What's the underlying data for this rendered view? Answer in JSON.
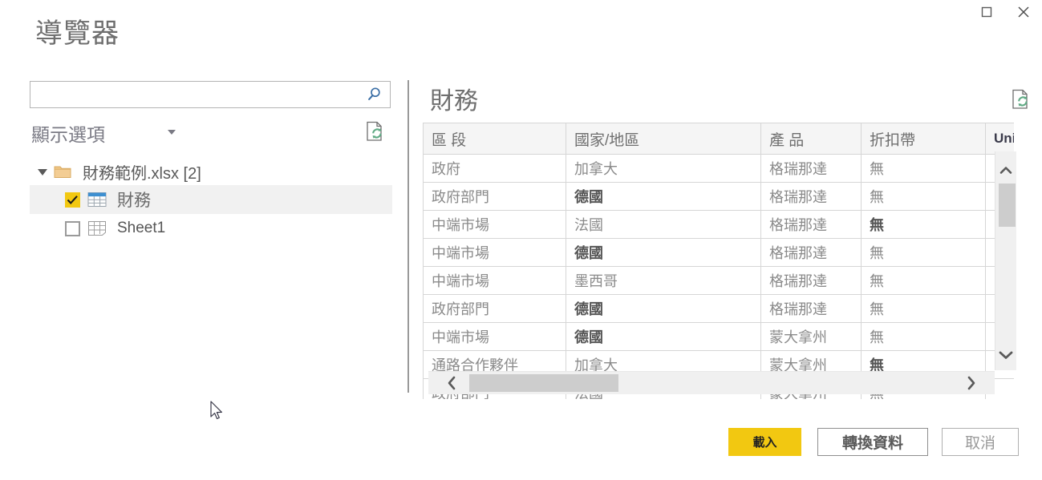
{
  "window": {
    "maximize_label": "maximize",
    "close_label": "close"
  },
  "dialog": {
    "title": "導覽器"
  },
  "search": {
    "value": "",
    "placeholder": "",
    "icon": "search-icon"
  },
  "options": {
    "show_options_label": "顯示選項",
    "caret_icon": "chevron-down-icon",
    "refresh_icon": "refresh-document-icon"
  },
  "tree": {
    "root": {
      "label": "財務範例.xlsx [2]",
      "icon": "folder-icon",
      "expanded": true
    },
    "children": [
      {
        "label": "財務",
        "icon": "table-icon",
        "checked": true,
        "selected": true
      },
      {
        "label": "Sheet1",
        "icon": "sheet-icon",
        "checked": false,
        "selected": false
      }
    ]
  },
  "preview": {
    "title": "財務",
    "refresh_icon": "refresh-document-icon",
    "columns": [
      "區 段",
      "國家/地區",
      "產 品",
      "折扣帶",
      "Uni"
    ],
    "rows": [
      {
        "cells": [
          "政府",
          "加拿大",
          "格瑞那達",
          "無",
          ""
        ],
        "emphasis": []
      },
      {
        "cells": [
          "政府部門",
          "德國",
          "格瑞那達",
          "無",
          ""
        ],
        "emphasis": [
          1
        ]
      },
      {
        "cells": [
          "中端市場",
          "法國",
          "格瑞那達",
          "無",
          ""
        ],
        "emphasis": [
          3
        ]
      },
      {
        "cells": [
          "中端市場",
          "德國",
          "格瑞那達",
          "無",
          ""
        ],
        "emphasis": [
          1
        ]
      },
      {
        "cells": [
          "中端市場",
          "墨西哥",
          "格瑞那達",
          "無",
          ""
        ],
        "emphasis": []
      },
      {
        "cells": [
          "政府部門",
          "德國",
          "格瑞那達",
          "無",
          ""
        ],
        "emphasis": [
          1
        ]
      },
      {
        "cells": [
          "中端市場",
          "德國",
          "蒙大拿州",
          "無",
          ""
        ],
        "emphasis": [
          1
        ]
      },
      {
        "cells": [
          "通路合作夥伴",
          "加拿大",
          "蒙大拿州",
          "無",
          ""
        ],
        "emphasis": [
          3
        ]
      },
      {
        "cells": [
          "政府部門",
          "法國",
          "蒙大拿州",
          "無",
          ""
        ],
        "emphasis": []
      }
    ]
  },
  "scrollbars": {
    "vertical": {
      "up_icon": "chevron-up-icon",
      "down_icon": "chevron-down-icon"
    },
    "horizontal": {
      "left_icon": "chevron-left-icon",
      "right_icon": "chevron-right-icon"
    }
  },
  "footer": {
    "load_label": "載入",
    "transform_label": "轉換資料",
    "cancel_label": "取消"
  },
  "colors": {
    "accent_yellow": "#f2c811",
    "search_icon_blue": "#3a6ea5",
    "refresh_green": "#6aab8e",
    "text_gray": "#6e6e6e"
  }
}
